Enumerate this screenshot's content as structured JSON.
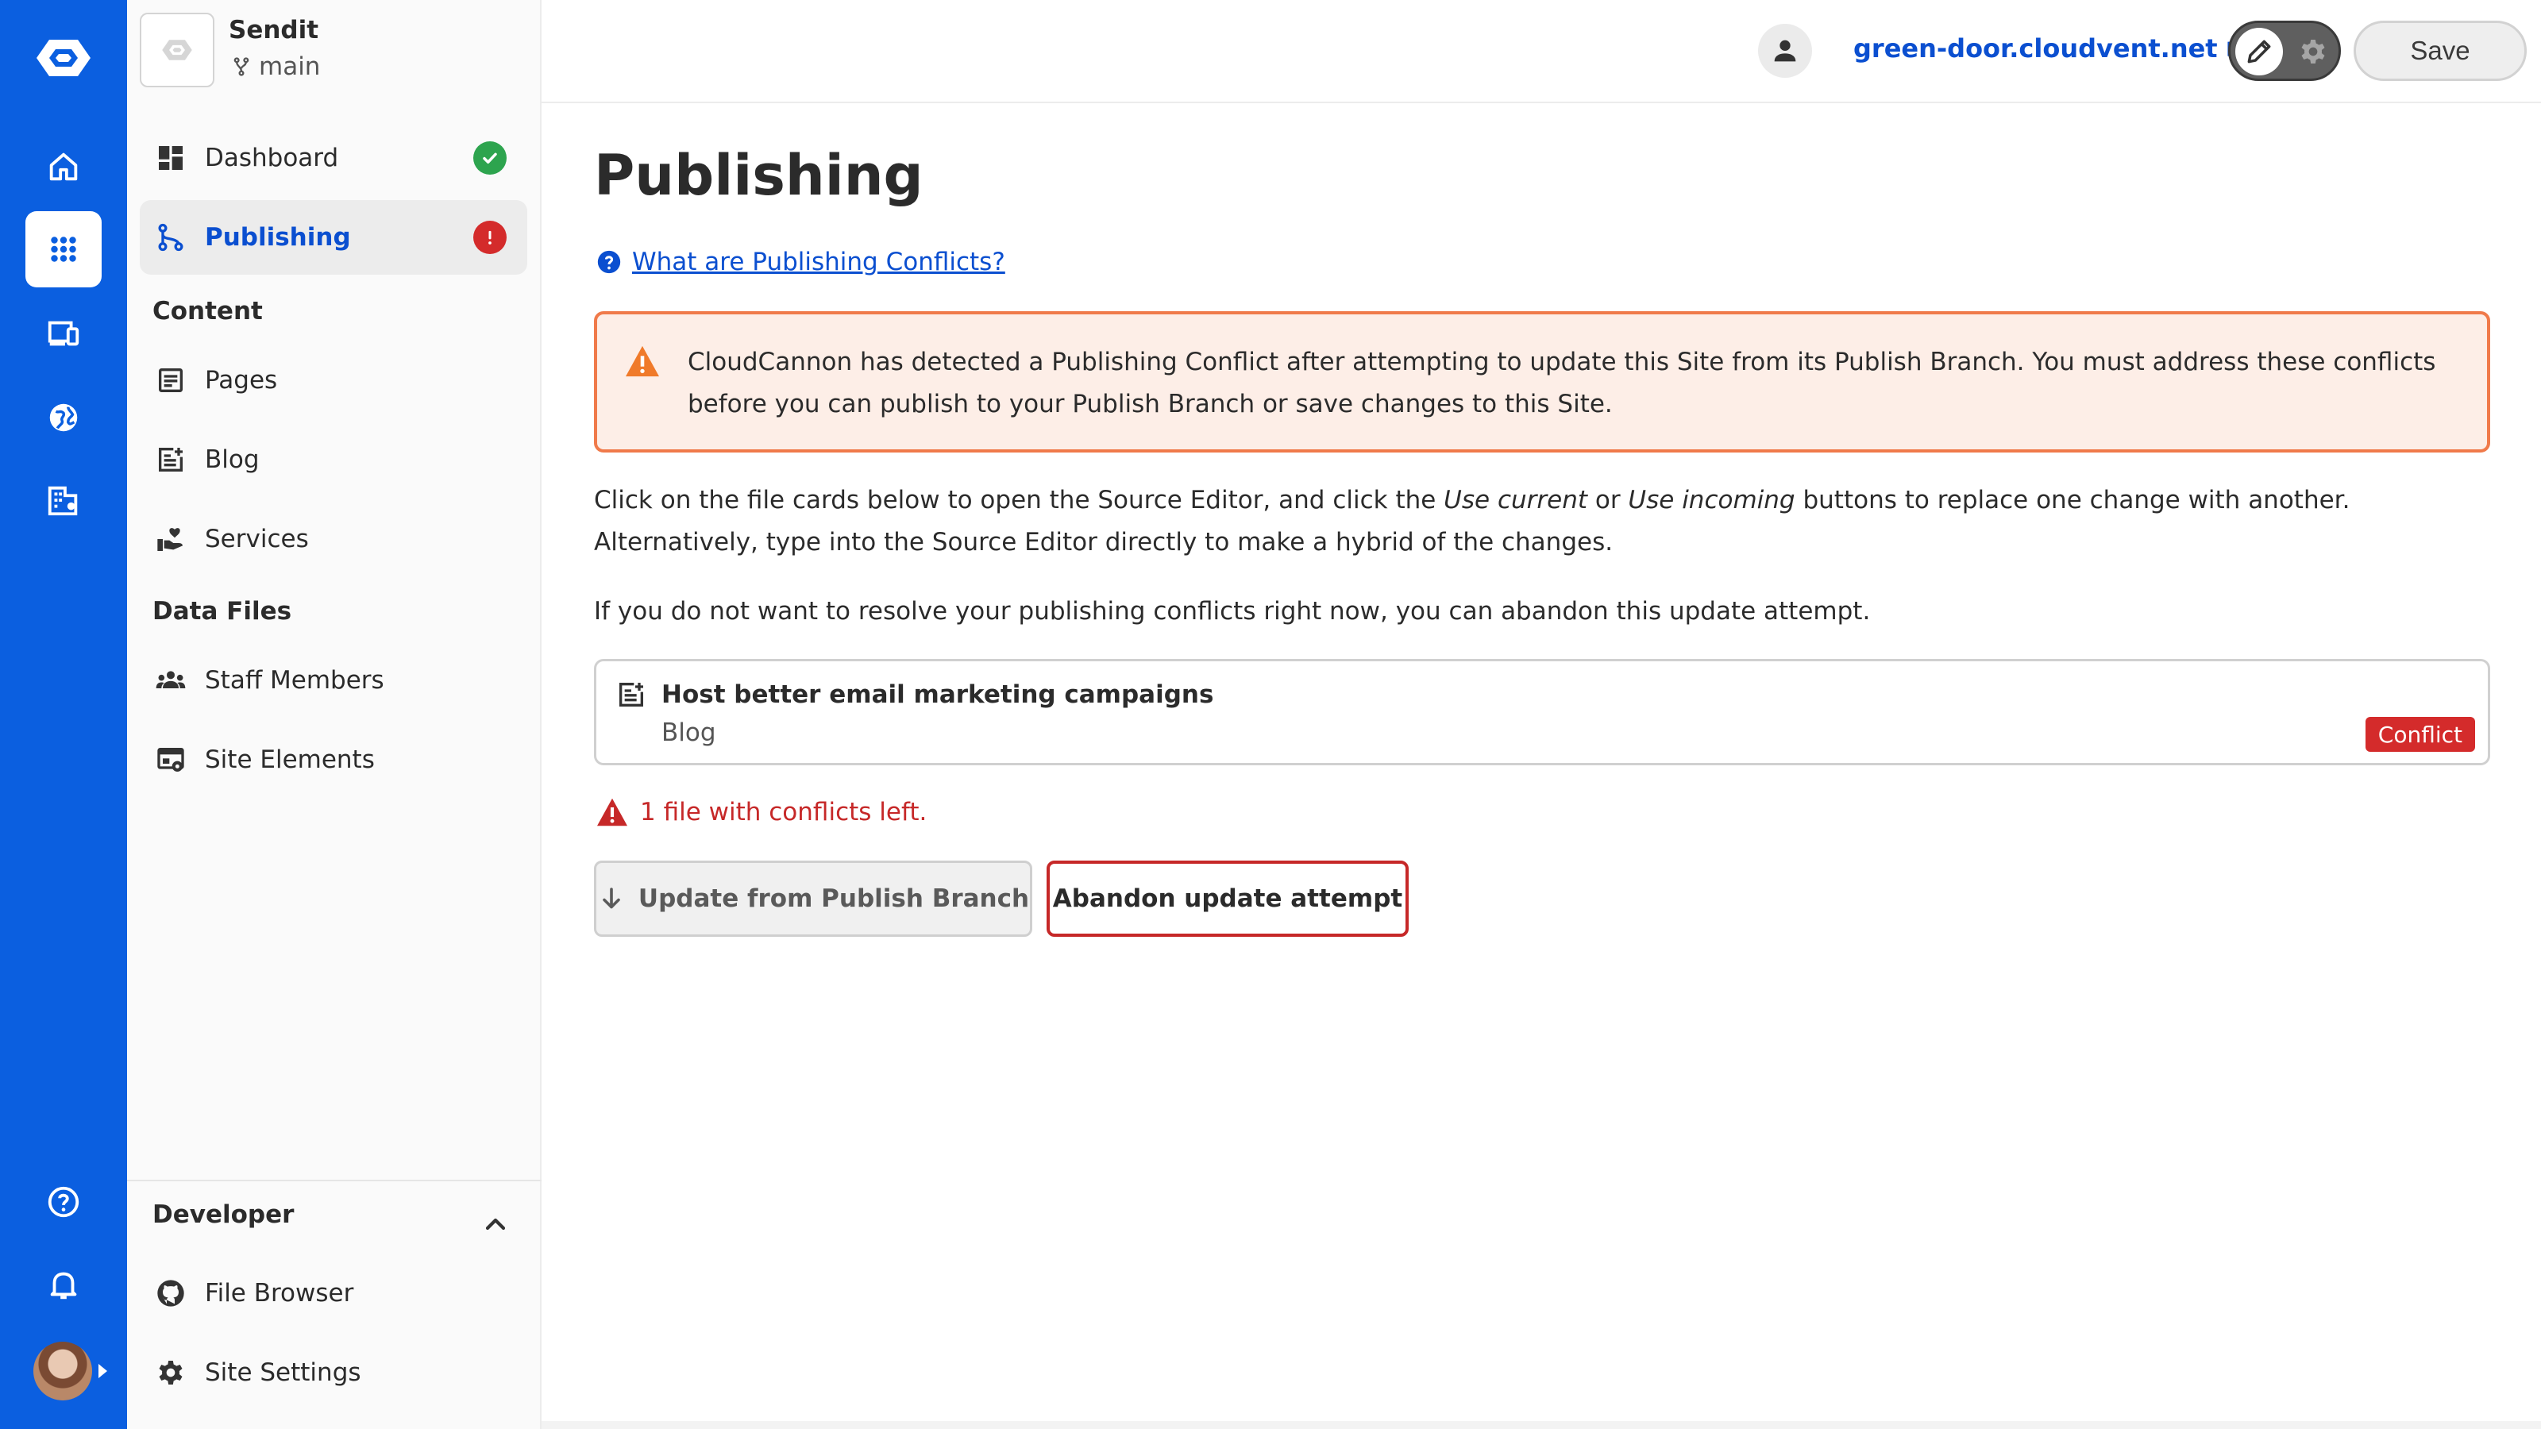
{
  "brand": {
    "accent": "#0b5fe0",
    "link": "#0b4fd0",
    "danger": "#c62828",
    "warning_border": "#f07a4a",
    "warning_bg": "#fdeee7",
    "success": "#2da44e"
  },
  "rail": {
    "items": [
      {
        "name": "home",
        "icon": "home-icon"
      },
      {
        "name": "apps",
        "icon": "apps-grid-icon",
        "active": true
      },
      {
        "name": "devices",
        "icon": "devices-icon"
      },
      {
        "name": "globe",
        "icon": "globe-icon"
      },
      {
        "name": "org",
        "icon": "organization-icon"
      },
      {
        "name": "help",
        "icon": "help-icon"
      },
      {
        "name": "notifications",
        "icon": "bell-icon"
      }
    ]
  },
  "site": {
    "name": "Sendit",
    "branch": "main"
  },
  "sidebar": {
    "dashboard": {
      "label": "Dashboard",
      "status": "ok"
    },
    "publishing": {
      "label": "Publishing",
      "status": "error"
    },
    "content_label": "Content",
    "content": [
      {
        "label": "Pages",
        "icon": "page-icon"
      },
      {
        "label": "Blog",
        "icon": "blog-icon"
      },
      {
        "label": "Services",
        "icon": "services-icon"
      }
    ],
    "data_files_label": "Data Files",
    "data_files": [
      {
        "label": "Staff Members",
        "icon": "people-icon"
      },
      {
        "label": "Site Elements",
        "icon": "site-elements-icon"
      }
    ],
    "developer_label": "Developer",
    "developer": [
      {
        "label": "File Browser",
        "icon": "github-icon"
      },
      {
        "label": "Site Settings",
        "icon": "gear-icon"
      }
    ]
  },
  "topbar": {
    "url": "green-door.cloudvent.net",
    "save_label": "Save"
  },
  "main": {
    "title": "Publishing",
    "help_link": "What are Publishing Conflicts?",
    "alert": "CloudCannon has detected a Publishing Conflict after attempting to update this Site from its Publish Branch. You must address these conflicts before you can publish to your Publish Branch or save changes to this Site.",
    "para1_a": "Click on the file cards below to open the Source Editor, and click the ",
    "para1_em1": "Use current",
    "para1_b": " or ",
    "para1_em2": "Use incoming",
    "para1_c": " buttons to replace one change with another. Alternatively, type into the Source Editor directly to make a hybrid of the changes.",
    "para2": "If you do not want to resolve your publishing conflicts right now, you can abandon this update attempt.",
    "file": {
      "title": "Host better email marketing campaigns",
      "collection": "Blog",
      "badge": "Conflict"
    },
    "conflicts_left": "1 file with conflicts left.",
    "update_button": "Update from Publish Branch",
    "abandon_button": "Abandon update attempt"
  }
}
